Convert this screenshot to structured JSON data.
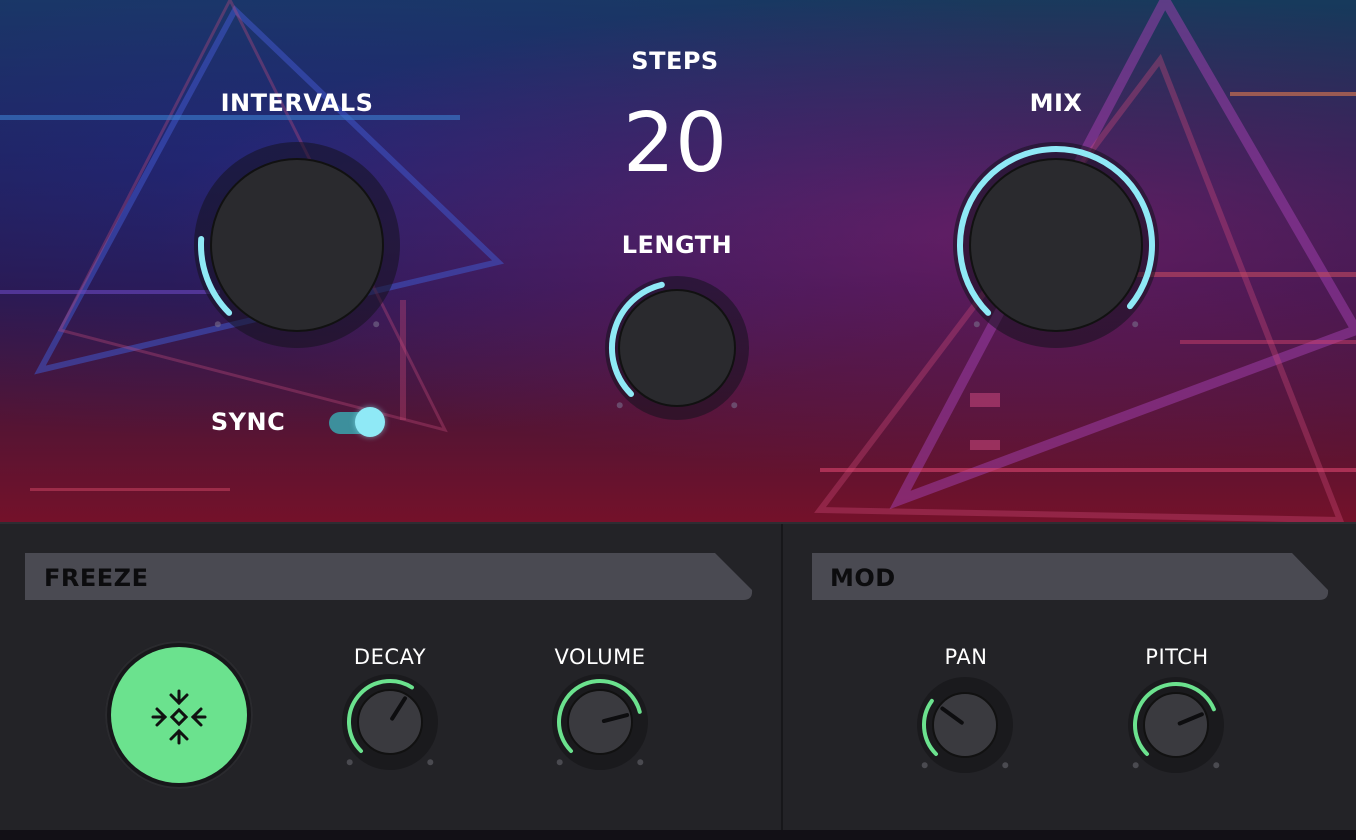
{
  "top": {
    "intervals_label": "INTERVALS",
    "steps_label": "STEPS",
    "steps_value": "20",
    "length_label": "LENGTH",
    "mix_label": "MIX",
    "sync_label": "SYNC",
    "sync_on": true
  },
  "knobs": {
    "intervals": {
      "value": 0.18
    },
    "length": {
      "value": 0.45
    },
    "mix": {
      "value": 0.98
    }
  },
  "freeze": {
    "header": "FREEZE",
    "decay_label": "DECAY",
    "volume_label": "VOLUME",
    "decay": {
      "value": 0.62
    },
    "volume": {
      "value": 0.78
    },
    "button_icon": "snowflake-freeze-icon"
  },
  "mod": {
    "header": "MOD",
    "pan_label": "PAN",
    "pitch_label": "PITCH",
    "pan": {
      "value": 0.3
    },
    "pitch": {
      "value": 0.75
    }
  },
  "colors": {
    "cyan_accent": "#8fe9f6",
    "green_accent": "#6be28e",
    "panel_bg": "#232327",
    "header_bar": "#4a4a52"
  }
}
